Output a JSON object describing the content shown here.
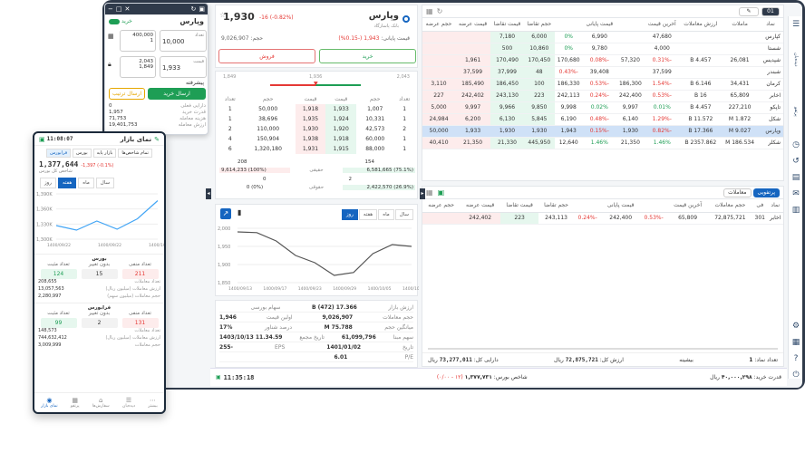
{
  "order_window": {
    "symbol": "وپارس",
    "side_label": "خرید",
    "volume_label": "تعداد",
    "volume": "10,000",
    "price_label": "قیمت",
    "price": "1,933",
    "stepper_top": "400,000",
    "stepper_top2": "1",
    "stepper_bot": "2,043",
    "stepper_bot2": "1,849",
    "advanced": "پیشرفته",
    "send_buy": "ارسال خرید",
    "buy_sell_option": "ارسال ترتیب",
    "stats": [
      {
        "k": "دارایی فعلی",
        "v": "0"
      },
      {
        "k": "قدرت خرید",
        "v": "1,957"
      },
      {
        "k": "هزینه معامله",
        "v": "71,753"
      },
      {
        "k": "ارزش معامله",
        "v": "19,401,753"
      }
    ]
  },
  "detail": {
    "symbol": "وپارس",
    "subtitle": "بانک پاسارگاد",
    "last_price": "1,930",
    "last_change": "-16 (-0.82%)",
    "close_label": "قیمت پایانی:",
    "close_value": "1,943 (-0.15%)",
    "volume_label": "حجم:",
    "volume": "9,026,907",
    "buy_button": "خرید",
    "sell_button": "فروش",
    "range_low": "1,849",
    "range_mid": "1,936",
    "range_high": "2,043",
    "ob_headers": [
      "تعداد",
      "حجم",
      "قیمت",
      "قیمت",
      "حجم",
      "تعداد"
    ],
    "orderbook": [
      {
        "n": "1",
        "vol": "50,000",
        "price": "1,918",
        "aprice": "1,933",
        "avol": "1,007",
        "an": "1"
      },
      {
        "n": "1",
        "vol": "38,696",
        "price": "1,935",
        "aprice": "1,924",
        "avol": "10,331",
        "an": "1"
      },
      {
        "n": "2",
        "vol": "110,000",
        "price": "1,930",
        "aprice": "1,920",
        "avol": "42,573",
        "an": "2"
      },
      {
        "n": "4",
        "vol": "150,904",
        "price": "1,938",
        "aprice": "1,918",
        "avol": "60,000",
        "an": "1"
      },
      {
        "n": "6",
        "vol": "1,320,180",
        "price": "1,931",
        "aprice": "1,915",
        "avol": "88,000",
        "an": "1"
      }
    ],
    "summary_left1": "208",
    "summary_left2": "9,614,233 (100%)",
    "summary_right1": "154",
    "summary_right2": "6,581,665 (75.1%)",
    "summary_mid1": "حقیقی",
    "summary_left3": "0",
    "summary_left4": "0 (0%)",
    "summary_right3": "2",
    "summary_right4": "2,422,570 (26.9%)",
    "summary_mid2": "حقوقی",
    "chart_tabs": [
      "روز",
      "هفته",
      "ماه",
      "سال"
    ],
    "chart_active": "روز",
    "info": [
      {
        "k": "ارزش بازار",
        "v": "17.366 B (472)",
        "k2": "سهام بورسی",
        "v2": ""
      },
      {
        "k": "حجم معاملات",
        "v": "9,026,907",
        "k2": "اولین قیمت",
        "v2": "1,946"
      },
      {
        "k": "میانگین حجم",
        "v": "75.788 M",
        "k2": "درصد شناور",
        "v2": "17%"
      },
      {
        "k": "سهم مبنا",
        "v": "61,099,796",
        "k2": "تاریخ مجمع",
        "v2": "11.34.59 1403/10/13"
      },
      {
        "k": "تاریخ",
        "v": "1401/01/02",
        "k2": "EPS",
        "v2": "-255"
      },
      {
        "k": "P/E",
        "v": "6.01",
        "k2": "",
        "v2": ""
      }
    ]
  },
  "chart_data": [
    {
      "type": "line",
      "x": [
        "1400/09/13",
        "1400/09/17",
        "1400/09/21",
        "1400/09/25",
        "1400/09/29",
        "1400/10/03",
        "1400/10/05",
        "1400/10/07",
        "1400/10/09",
        "1400/10/11"
      ],
      "y": [
        1990,
        1988,
        1965,
        1925,
        1905,
        1870,
        1878,
        1930,
        1955,
        1950
      ],
      "ylim": [
        1850,
        2000
      ],
      "yticks": [
        "2,000",
        "1,950",
        "1,900",
        "1,850"
      ],
      "xticks": [
        "1400/09/13",
        "1400/09/17",
        "1400/09/23",
        "1400/09/29",
        "1400/10/05",
        "1400/10/11"
      ]
    },
    {
      "type": "line",
      "x": [
        "1400/09/22",
        "1400/09/26",
        "1400/09/30",
        "1400/10/04",
        "1400/10/08",
        "1400/10/12"
      ],
      "y": [
        1330000,
        1320000,
        1340000,
        1322000,
        1345000,
        1385000
      ],
      "ylim": [
        1300000,
        1400000
      ],
      "yticks": [
        "1,390K",
        "1,360K",
        "1,330K",
        "1,300K"
      ],
      "xticks": [
        "1400/09/22",
        "1400/09/22",
        "1400/10/12"
      ]
    }
  ],
  "watchlist": {
    "headers": [
      "نماد",
      "ماملات",
      "ارزش معاملات",
      "آخرین قیمت",
      "",
      "قیمت پایانی",
      "",
      "حجم تقاضا",
      "قیمت تقاضا",
      "قیمت عرضه",
      "حجم عرضه"
    ],
    "rows": [
      {
        "sym": "کپارس",
        "a": "",
        "b": "",
        "last": "47,680",
        "lc": "",
        "close": "6,990",
        "cc": "0%",
        "bv": "6,000",
        "bp": "7,180",
        "ap": "",
        "av": "",
        "cls": "g"
      },
      {
        "sym": "شستا",
        "a": "",
        "b": "",
        "last": "4,000",
        "lc": "",
        "close": "9,780",
        "cc": "0%",
        "bv": "10,860",
        "bp": "500",
        "ap": "",
        "av": "",
        "cls": "g"
      },
      {
        "sym": "شپدیس",
        "a": "26,081",
        "b": "4.457 B",
        "last": "-0.31%",
        "lc": "57,320",
        "close": "-0.08%",
        "cc": "170,680",
        "bv": "170,450",
        "bp": "170,490",
        "ap": "1,961",
        "av": "",
        "cls": "r"
      },
      {
        "sym": "شبندر",
        "a": "",
        "b": "",
        "last": "37,599",
        "lc": "",
        "close": "39,408",
        "cc": "-0.43%",
        "bv": "48",
        "bp": "37,999",
        "ap": "37,599",
        "av": "",
        "cls": "r"
      },
      {
        "sym": "کرمان",
        "a": "34,431",
        "b": "6.146 B",
        "last": "-1.54%",
        "lc": "186,300",
        "close": "-0.53%",
        "cc": "186,330",
        "bv": "100",
        "bp": "186,450",
        "ap": "185,490",
        "av": "3,110",
        "cls": "r"
      },
      {
        "sym": "اخابر",
        "a": "65,809",
        "b": "16 B",
        "last": "-0.53%",
        "lc": "242,400",
        "close": "-0.24%",
        "cc": "242,113",
        "bv": "223",
        "bp": "243,130",
        "ap": "242,402",
        "av": "227",
        "cls": "r"
      },
      {
        "sym": "تاپکو",
        "a": "227,210",
        "b": "4.457 B",
        "last": "0.01%",
        "lc": "9,997",
        "close": "0.02%",
        "cc": "9,998",
        "bv": "9,850",
        "bp": "9,966",
        "ap": "9,997",
        "av": "5,000",
        "cls": "g"
      },
      {
        "sym": "شکل",
        "a": "1.872 M",
        "b": "11.572 B",
        "last": "-1.29%",
        "lc": "6,140",
        "close": "-0.48%",
        "cc": "6,190",
        "bv": "5,845",
        "bp": "6,130",
        "ap": "6,200",
        "av": "24,984",
        "cls": "r"
      },
      {
        "sym": "وپارس",
        "a": "9.027 M",
        "b": "17.366 B",
        "last": "-0.82%",
        "lc": "1,930",
        "close": "-0.15%",
        "cc": "1,943",
        "bv": "1,930",
        "bp": "1,930",
        "ap": "1,933",
        "av": "50,000",
        "cls": "r",
        "sel": true
      },
      {
        "sym": "شکلر",
        "a": "186.534 M",
        "b": "2357.862 B",
        "last": "1.46%",
        "lc": "21,350",
        "close": "1.46%",
        "cc": "12,640",
        "bv": "445,950",
        "bp": "21,330",
        "ap": "21,350",
        "av": "40,410",
        "cls": "g"
      }
    ],
    "stock_id_badge": "01"
  },
  "positions": {
    "tabs": [
      "پرتفویی",
      "معاملات"
    ],
    "headers": [
      "نماد",
      "",
      "فی",
      "حجم معاملات",
      "آخرین قیمت",
      "",
      "قیمت پایانی",
      "",
      "حجم تقاضا",
      "قیمت تقاضا",
      "قیمت عرضه",
      "حجم عرضه"
    ],
    "row": {
      "sym": "اخابر",
      "n": "301",
      "vol": "72,875,721",
      "last": "65,809",
      "lc": "-0.53%",
      "close": "242,400",
      "cc": "-0.24%",
      "bv": "243,113",
      "bp": "223",
      "ap": "242,402",
      "av": ""
    },
    "footer_count_label": "تعداد نماد:",
    "footer_count": "1",
    "footer_value_label": "ارزش کل:",
    "footer_value": "72,875,721",
    "footer_value_unit": "ریال",
    "footer_buy_label": "دارایی کل:",
    "footer_buy": "73,277,011",
    "footer_buy_unit": "ریال",
    "footer_pl": "بیشینه"
  },
  "statusbar": {
    "time": "11:35:18",
    "index_label": "شاخص بورس:",
    "index_value": "۱,۳۷۷,۷۳۱",
    "index_change": "(۱۲ - ۰/۰۰)",
    "buy_power_label": "قدرت خرید:",
    "buy_power": "۴۰,۰۰۰,۲۹۸",
    "buy_power_unit": "ریال"
  },
  "mobile": {
    "title": "نمای بازار",
    "time": "11:08:07",
    "tabs": [
      "فرابورس",
      "بورس",
      "بازار پایه",
      "تمام شاخص‌ها"
    ],
    "index_value": "1,377,644",
    "index_change": "-1,397 (-0.1%)",
    "index_label": "شاخص کل بورس",
    "range_tabs": [
      "روز",
      "هفته",
      "ماه",
      "سال"
    ],
    "range_active": "هفته",
    "sections": [
      {
        "title": "بورس",
        "cols": [
          "تعداد مثبت",
          "بدون تغییر",
          "تعداد منفی"
        ],
        "vals": [
          "124",
          "15",
          "211"
        ],
        "rows": [
          {
            "k": "تعداد معاملات",
            "v": "208,655"
          },
          {
            "k": "ارزش معاملات (میلیون ریال)",
            "v": "13,057,563"
          },
          {
            "k": "حجم معاملات (میلیون سهم)",
            "v": "2,280,997"
          }
        ]
      },
      {
        "title": "فرابورس",
        "cols": [
          "تعداد مثبت",
          "بدون تغییر",
          "تعداد منفی"
        ],
        "vals": [
          "99",
          "2",
          "131"
        ],
        "rows": [
          {
            "k": "تعداد معاملات",
            "v": "148,573"
          },
          {
            "k": "ارزش معاملات (میلیون ریال)",
            "v": "744,632,412"
          },
          {
            "k": "حجم معاملات",
            "v": "3,009,999"
          }
        ]
      }
    ],
    "nav": [
      "نمای بازار",
      "پرتفو",
      "سفارش‌ها",
      "دیده‌بان",
      "بیشتر"
    ]
  },
  "colors": {
    "brand": "#1565c0",
    "buy": "#1e9e55",
    "sell": "#e53935",
    "frame": "#2f3a4a"
  }
}
